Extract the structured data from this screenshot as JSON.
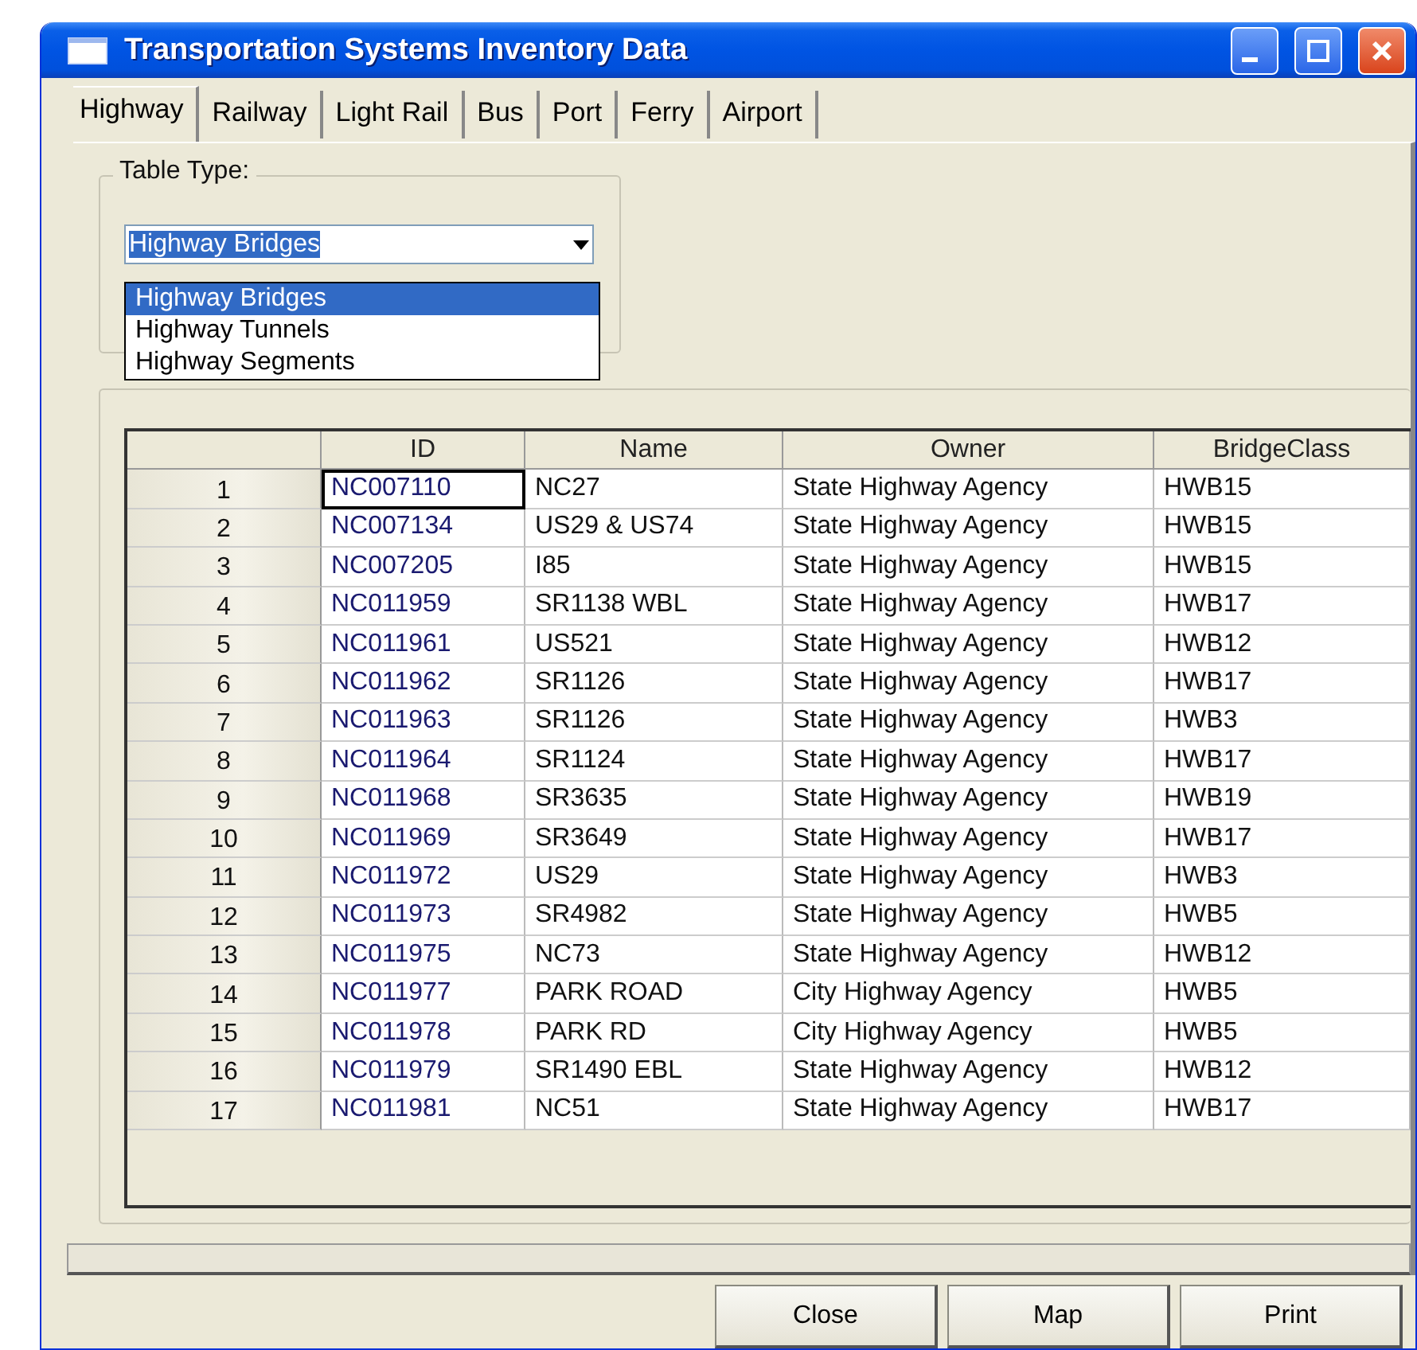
{
  "window": {
    "title": "Transportation Systems Inventory Data"
  },
  "tabs": [
    {
      "label": "Highway",
      "selected": true
    },
    {
      "label": "Railway",
      "selected": false
    },
    {
      "label": "Light Rail",
      "selected": false
    },
    {
      "label": "Bus",
      "selected": false
    },
    {
      "label": "Port",
      "selected": false
    },
    {
      "label": "Ferry",
      "selected": false
    },
    {
      "label": "Airport",
      "selected": false
    }
  ],
  "table_type": {
    "label": "Table Type:",
    "value": "Highway Bridges",
    "expanded": true,
    "options": [
      {
        "label": "Highway Bridges",
        "selected": true
      },
      {
        "label": "Highway Tunnels",
        "selected": false
      },
      {
        "label": "Highway Segments",
        "selected": false
      }
    ]
  },
  "table": {
    "columns": [
      "ID",
      "Name",
      "Owner",
      "BridgeClass"
    ],
    "rows": [
      {
        "number": "1",
        "cells": [
          "NC007110",
          "NC27",
          "State Highway Agency",
          "HWB15"
        ],
        "selected": true
      },
      {
        "number": "2",
        "cells": [
          "NC007134",
          "US29 & US74",
          "State Highway Agency",
          "HWB15"
        ],
        "selected": false
      },
      {
        "number": "3",
        "cells": [
          "NC007205",
          "I85",
          "State Highway Agency",
          "HWB15"
        ],
        "selected": false
      },
      {
        "number": "4",
        "cells": [
          "NC011959",
          "SR1138 WBL",
          "State Highway Agency",
          "HWB17"
        ],
        "selected": false
      },
      {
        "number": "5",
        "cells": [
          "NC011961",
          "US521",
          "State Highway Agency",
          "HWB12"
        ],
        "selected": false
      },
      {
        "number": "6",
        "cells": [
          "NC011962",
          "SR1126",
          "State Highway Agency",
          "HWB17"
        ],
        "selected": false
      },
      {
        "number": "7",
        "cells": [
          "NC011963",
          "SR1126",
          "State Highway Agency",
          "HWB3"
        ],
        "selected": false
      },
      {
        "number": "8",
        "cells": [
          "NC011964",
          "SR1124",
          "State Highway Agency",
          "HWB17"
        ],
        "selected": false
      },
      {
        "number": "9",
        "cells": [
          "NC011968",
          "SR3635",
          "State Highway Agency",
          "HWB19"
        ],
        "selected": false
      },
      {
        "number": "10",
        "cells": [
          "NC011969",
          "SR3649",
          "State Highway Agency",
          "HWB17"
        ],
        "selected": false
      },
      {
        "number": "11",
        "cells": [
          "NC011972",
          "US29",
          "State Highway Agency",
          "HWB3"
        ],
        "selected": false
      },
      {
        "number": "12",
        "cells": [
          "NC011973",
          "SR4982",
          "State Highway Agency",
          "HWB5"
        ],
        "selected": false
      },
      {
        "number": "13",
        "cells": [
          "NC011975",
          "NC73",
          "State Highway Agency",
          "HWB12"
        ],
        "selected": false
      },
      {
        "number": "14",
        "cells": [
          "NC011977",
          "PARK ROAD",
          "City Highway Agency",
          "HWB5"
        ],
        "selected": false
      },
      {
        "number": "15",
        "cells": [
          "NC011978",
          "PARK RD",
          "City Highway Agency",
          "HWB5"
        ],
        "selected": false
      },
      {
        "number": "16",
        "cells": [
          "NC011979",
          "SR1490 EBL",
          "State Highway Agency",
          "HWB12"
        ],
        "selected": false
      },
      {
        "number": "17",
        "cells": [
          "NC011981",
          "NC51",
          "State Highway Agency",
          "HWB17"
        ],
        "selected": false
      }
    ]
  },
  "buttons": [
    "Close",
    "Map",
    "Print"
  ]
}
